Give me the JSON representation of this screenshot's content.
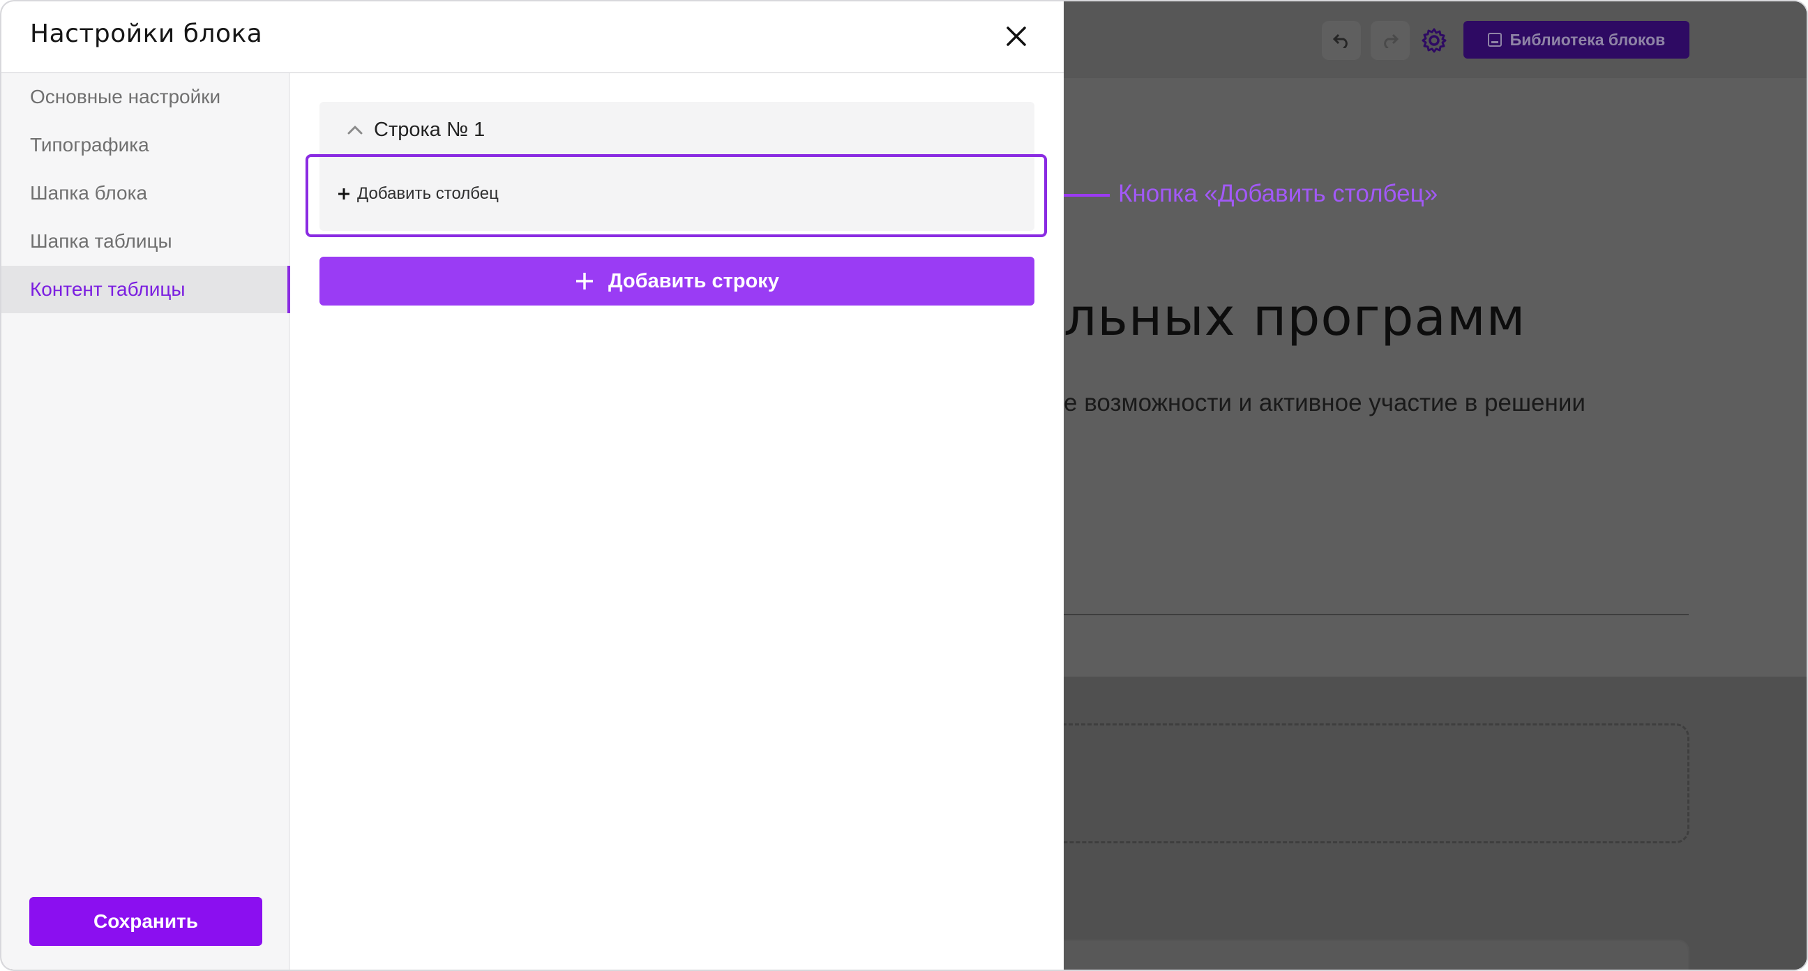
{
  "modal": {
    "title": "Настройки блока"
  },
  "sidebar": {
    "items": [
      {
        "label": "Основные настройки",
        "active": false
      },
      {
        "label": "Типографика",
        "active": false
      },
      {
        "label": "Шапка блока",
        "active": false
      },
      {
        "label": "Шапка таблицы",
        "active": false
      },
      {
        "label": "Контент таблицы",
        "active": true
      }
    ],
    "save_label": "Сохранить"
  },
  "content": {
    "row_title": "Строка № 1",
    "add_column_label": "Добавить столбец",
    "add_row_label": "Добавить строку"
  },
  "annotation": {
    "text": "Кнопка «Добавить столбец»"
  },
  "background_page": {
    "library_button_label": "Библиотека блоков",
    "heading_fragment": "льных программ",
    "subtitle_fragment": "е возможности и активное участие в решении"
  },
  "colors": {
    "accent": "#8b0ff0",
    "add_row_button": "#9a3cf4",
    "highlight_border": "#8a2be2",
    "annotation": "#a259f7",
    "overlay": "#5c5c5c"
  },
  "icons": {
    "close": "close-icon",
    "chevron": "chevron-up-icon",
    "plus": "plus-icon",
    "undo": "undo-icon",
    "redo": "redo-icon",
    "settings": "gear-icon",
    "library": "library-icon"
  }
}
